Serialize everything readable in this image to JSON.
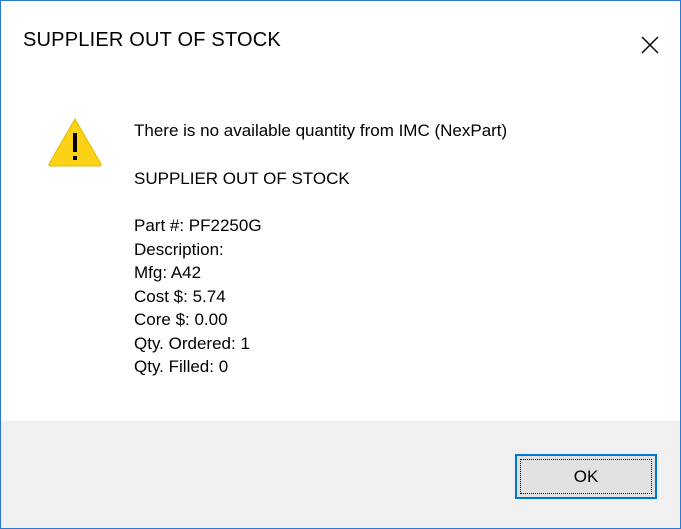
{
  "window": {
    "title": "SUPPLIER OUT OF STOCK",
    "close_icon": "close-icon"
  },
  "icon": {
    "name": "warning-icon",
    "color": "#fcd116"
  },
  "message": {
    "lines": [
      "There is no available quantity from IMC (NexPart)",
      "SUPPLIER OUT OF STOCK",
      "Part #: PF2250G",
      "Description:",
      "Mfg: A42",
      "Cost $: 5.74",
      "Core $: 0.00",
      "Qty. Ordered: 1",
      "Qty. Filled: 0"
    ]
  },
  "buttons": {
    "ok_label": "OK"
  },
  "colors": {
    "border": "#2b79d0",
    "footer_bg": "#f0f0f0",
    "button_bg": "#e1e1e1",
    "button_border": "#0078d7"
  }
}
